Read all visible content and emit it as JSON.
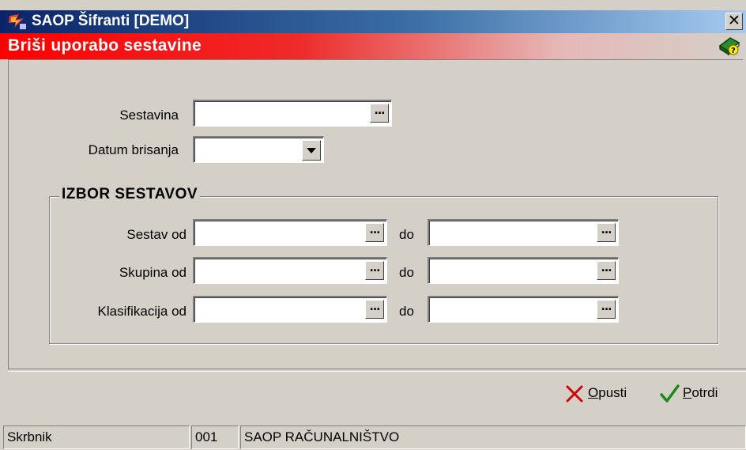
{
  "window": {
    "title": "SAOP Šifranti [DEMO]",
    "close_label": "✕",
    "form_title": "Briši uporabo sestavine",
    "title_bar_color": "#0a246a",
    "header_color": "#ff0000"
  },
  "form": {
    "sestavina": {
      "label": "Sestavina",
      "value": ""
    },
    "datum": {
      "label": "Datum brisanja",
      "value": ""
    },
    "browse_label": "...",
    "group": {
      "title": "IZBOR SESTAVOV",
      "to_label": "do",
      "rows": [
        {
          "label": "Sestav od",
          "from": "",
          "to": ""
        },
        {
          "label": "Skupina od",
          "from": "",
          "to": ""
        },
        {
          "label": "Klasifikacija od",
          "from": "",
          "to": ""
        }
      ]
    }
  },
  "actions": {
    "cancel": {
      "mnemonic": "O",
      "rest": "pusti",
      "icon": "red-x-icon",
      "color": "#d40000"
    },
    "confirm": {
      "mnemonic": "P",
      "rest": "otrdi",
      "icon": "green-check-icon",
      "color": "#1a8a1a"
    }
  },
  "status": {
    "user": "Skrbnik",
    "company_code": "001",
    "company_name": "SAOP RAČUNALNIŠTVO"
  }
}
